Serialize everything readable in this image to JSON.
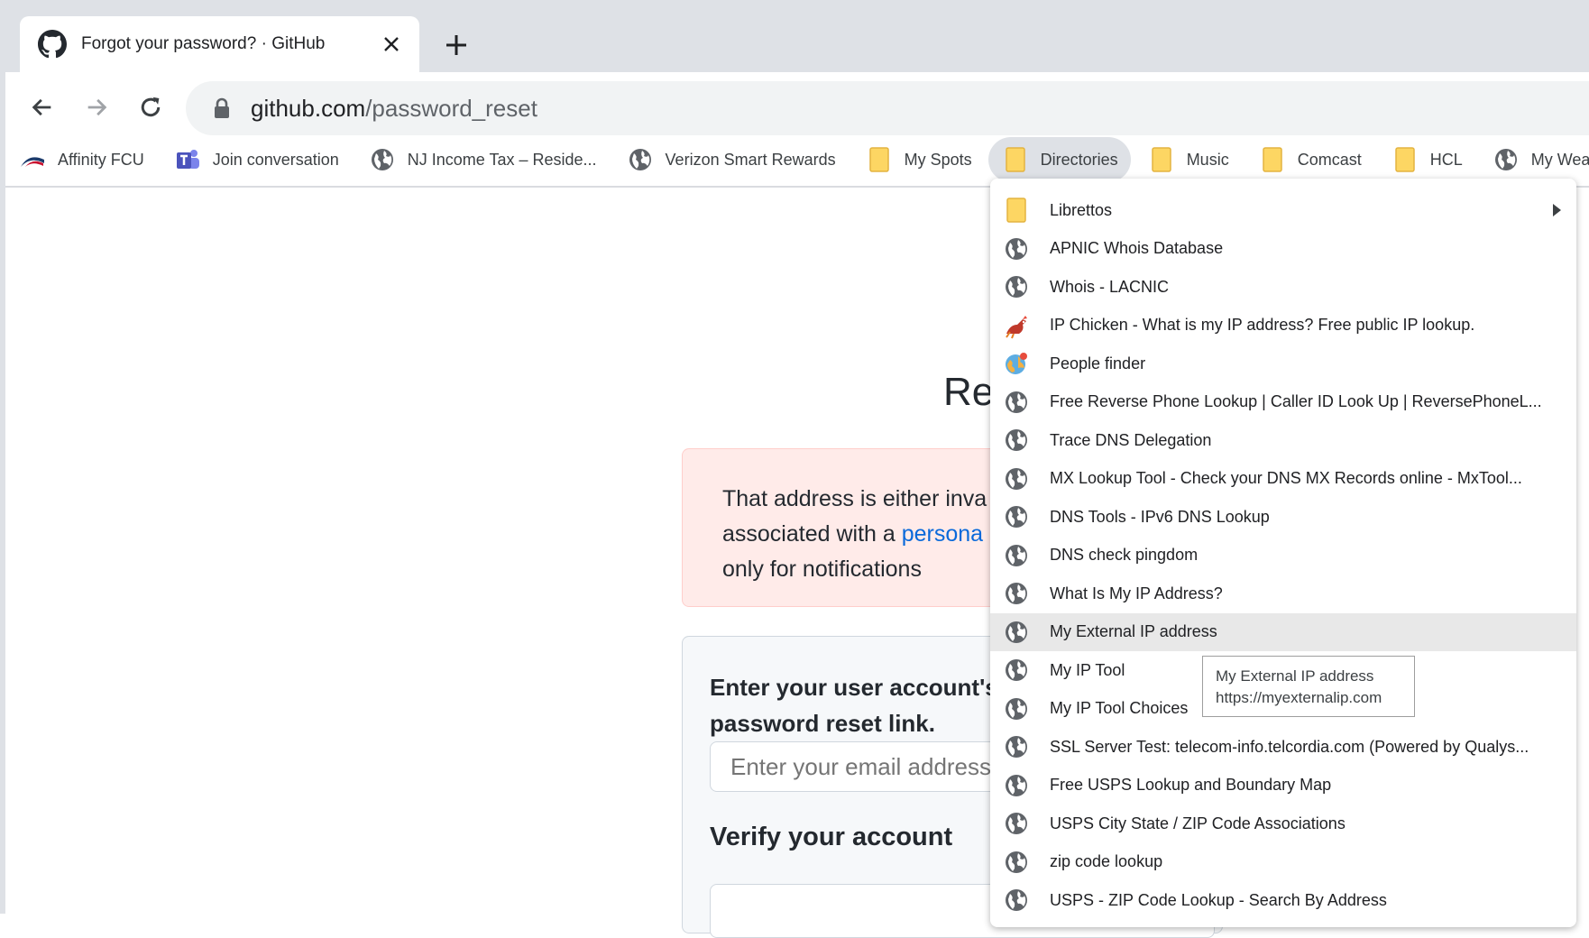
{
  "tab": {
    "title": "Forgot your password? · GitHub"
  },
  "omnibox": {
    "host": "github.com",
    "path": "/password_reset"
  },
  "bookmarks": [
    {
      "label": "Affinity FCU",
      "icon": "affinity-logo-icon"
    },
    {
      "label": "Join conversation",
      "icon": "teams-icon"
    },
    {
      "label": "NJ Income Tax – Reside...",
      "icon": "globe-icon"
    },
    {
      "label": "Verizon Smart Rewards",
      "icon": "globe-icon"
    },
    {
      "label": "My Spots",
      "icon": "folder-icon"
    },
    {
      "label": "Directories",
      "icon": "folder-icon",
      "active": true
    },
    {
      "label": "Music",
      "icon": "folder-icon"
    },
    {
      "label": "Comcast",
      "icon": "folder-icon"
    },
    {
      "label": "HCL",
      "icon": "folder-icon"
    },
    {
      "label": "My Weat",
      "icon": "globe-icon"
    }
  ],
  "page": {
    "heading": "Res",
    "flash_line1": "That address is either inva",
    "flash_line2_prefix": "associated with a ",
    "flash_link": "persona",
    "flash_line3": "only for notifications",
    "form_label_line1": "Enter your user account's v",
    "form_label_line2": "password reset link.",
    "email_placeholder": "Enter your email address",
    "verify_heading": "Verify your account"
  },
  "menu": {
    "items": [
      {
        "label": "Librettos",
        "icon": "folder-icon",
        "submenu": true
      },
      {
        "label": "APNIC Whois Database",
        "icon": "globe-icon"
      },
      {
        "label": "Whois - LACNIC",
        "icon": "globe-icon"
      },
      {
        "label": "IP Chicken - What is my IP address? Free public IP lookup.",
        "icon": "chicken-icon"
      },
      {
        "label": "People finder",
        "icon": "people-finder-icon"
      },
      {
        "label": "Free Reverse Phone Lookup | Caller ID Look Up | ReversePhoneL...",
        "icon": "globe-icon"
      },
      {
        "label": "Trace DNS Delegation",
        "icon": "globe-icon"
      },
      {
        "label": "MX Lookup Tool - Check your DNS MX Records online - MxTool...",
        "icon": "globe-icon"
      },
      {
        "label": "DNS Tools - IPv6 DNS Lookup",
        "icon": "globe-icon"
      },
      {
        "label": "DNS check pingdom",
        "icon": "globe-icon"
      },
      {
        "label": "What Is My IP Address?",
        "icon": "globe-icon"
      },
      {
        "label": "My External IP address",
        "icon": "globe-icon",
        "hover": true
      },
      {
        "label": "My IP Tool",
        "icon": "globe-icon"
      },
      {
        "label": "My IP Tool Choices",
        "icon": "globe-icon"
      },
      {
        "label": "SSL Server Test: telecom-info.telcordia.com (Powered by Qualys...",
        "icon": "globe-icon"
      },
      {
        "label": "Free USPS Lookup and Boundary Map",
        "icon": "globe-icon"
      },
      {
        "label": "USPS City State / ZIP Code Associations",
        "icon": "globe-icon"
      },
      {
        "label": "zip code lookup",
        "icon": "globe-icon"
      },
      {
        "label": "USPS - ZIP Code Lookup - Search By Address",
        "icon": "globe-icon"
      }
    ]
  },
  "tooltip": {
    "title": "My External IP address",
    "url": "https://myexternalip.com"
  }
}
